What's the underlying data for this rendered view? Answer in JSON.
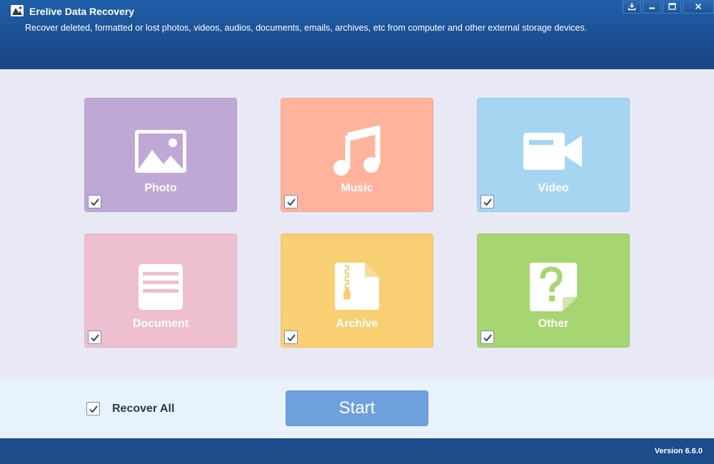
{
  "window": {
    "title": "Erelive Data Recovery",
    "subtitle": "Recover deleted, formatted or lost photos, videos, audios, documents, emails, archives, etc from computer and other external storage devices.",
    "controls": [
      "download-icon",
      "minimize-icon",
      "maximize-icon",
      "close-icon"
    ]
  },
  "categories": [
    {
      "label": "Photo",
      "icon": "photo-icon",
      "color": "#bfa8d4",
      "checked": true
    },
    {
      "label": "Music",
      "icon": "music-icon",
      "color": "#ffb39c",
      "checked": true
    },
    {
      "label": "Video",
      "icon": "video-icon",
      "color": "#a6d5f2",
      "checked": true
    },
    {
      "label": "Document",
      "icon": "document-icon",
      "color": "#edbfd0",
      "checked": true
    },
    {
      "label": "Archive",
      "icon": "archive-icon",
      "color": "#f9cf74",
      "checked": true
    },
    {
      "label": "Other",
      "icon": "question-file-icon",
      "color": "#a7d571",
      "checked": true
    }
  ],
  "bottom": {
    "recover_all_label": "Recover All",
    "recover_all_checked": true,
    "start_label": "Start"
  },
  "status": {
    "version": "Version 6.6.0"
  },
  "colors": {
    "title_bar": "#1c4f92",
    "content_bg": "#e9e9f6",
    "bottom_bg": "#e8f2fb",
    "start_button": "#6fa0de",
    "status_bar": "#1c4c8a"
  }
}
